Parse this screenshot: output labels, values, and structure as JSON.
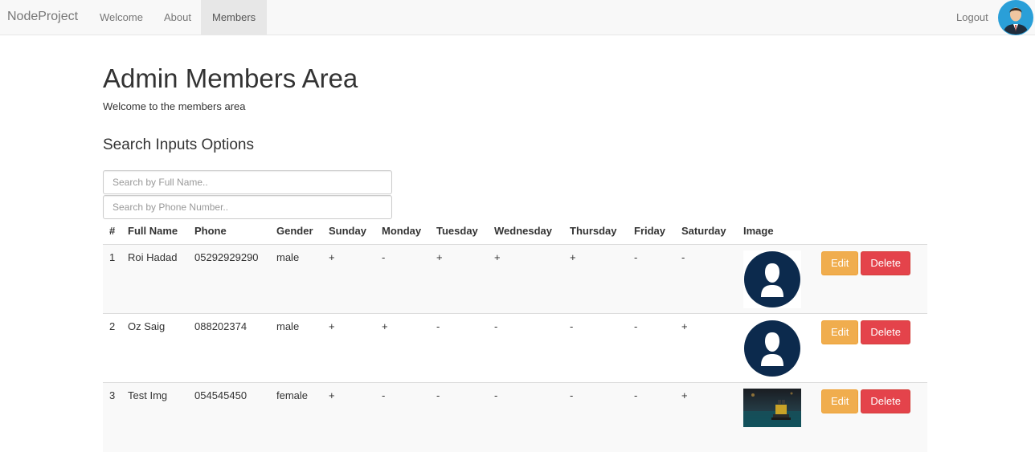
{
  "navbar": {
    "brand": "NodeProject",
    "links": [
      {
        "label": "Welcome",
        "active": false
      },
      {
        "label": "About",
        "active": false
      },
      {
        "label": "Members",
        "active": true
      }
    ],
    "logout_label": "Logout",
    "avatar_icon": "user-avatar-icon"
  },
  "page": {
    "title": "Admin Members Area",
    "subtitle": "Welcome to the members area",
    "section_title": "Search Inputs Options"
  },
  "search": {
    "name_placeholder": "Search by Full Name..",
    "name_value": "",
    "phone_placeholder": "Search by Phone Number..",
    "phone_value": ""
  },
  "table": {
    "headers": [
      "#",
      "Full Name",
      "Phone",
      "Gender",
      "Sunday",
      "Monday",
      "Tuesday",
      "Wednesday",
      "Thursday",
      "Friday",
      "Saturday",
      "Image",
      ""
    ],
    "rows": [
      {
        "num": "1",
        "name": "Roi Hadad",
        "phone": "05292929290",
        "gender": "male",
        "days": [
          "+",
          "-",
          "+",
          "+",
          "+",
          "-",
          "-"
        ],
        "image": "default-avatar-icon",
        "edit_label": "Edit",
        "delete_label": "Delete"
      },
      {
        "num": "2",
        "name": "Oz Saig",
        "phone": "088202374",
        "gender": "male",
        "days": [
          "+",
          "+",
          "-",
          "-",
          "-",
          "-",
          "+"
        ],
        "image": "default-avatar-icon",
        "edit_label": "Edit",
        "delete_label": "Delete"
      },
      {
        "num": "3",
        "name": "Test Img",
        "phone": "054545450",
        "gender": "female",
        "days": [
          "+",
          "-",
          "-",
          "-",
          "-",
          "-",
          "+"
        ],
        "image": "robot-photo",
        "edit_label": "Edit",
        "delete_label": "Delete"
      }
    ]
  },
  "colors": {
    "avatar_navy": "#0c2a4d",
    "edit_button": "#f0ad4e",
    "delete_button": "#e4434b",
    "navbar_bg": "#f8f8f8",
    "nav_avatar_bg": "#2a9fd8"
  }
}
